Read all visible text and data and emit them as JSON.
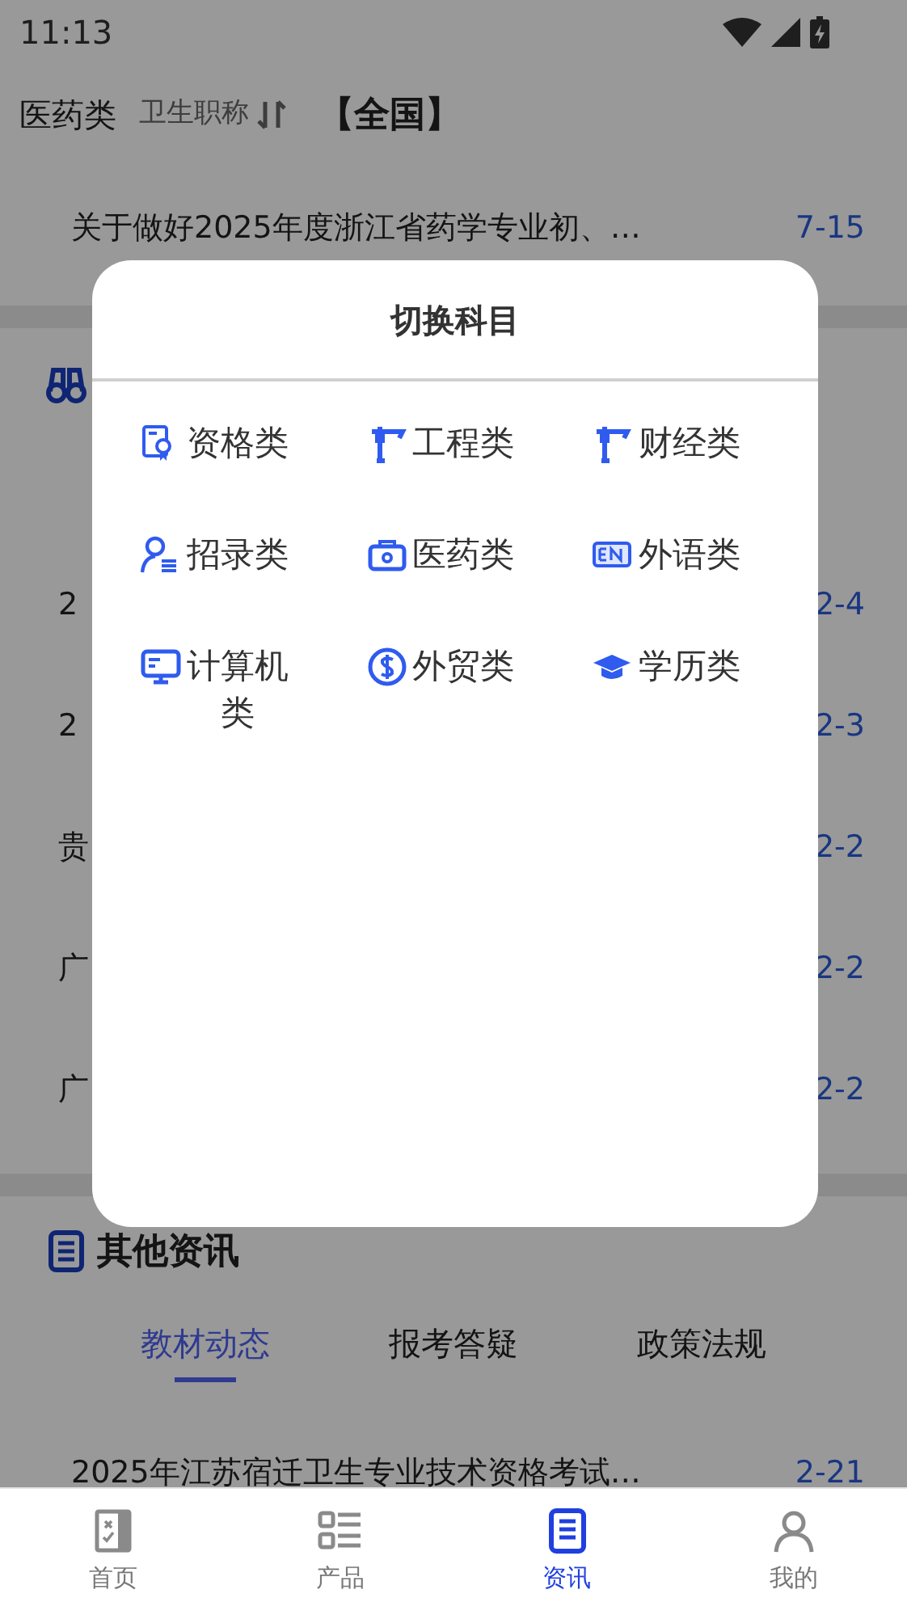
{
  "status_bar": {
    "time": "11:13"
  },
  "header": {
    "category": "医药类",
    "subcategory": "卫生职称",
    "region": "【全国】"
  },
  "top_news": [
    {
      "title": "关于做好2025年度浙江省药学专业初、…",
      "date": "7-15"
    }
  ],
  "section_rows": [
    {
      "title": "2",
      "date": "2-4"
    },
    {
      "title": "2",
      "date": "2-3"
    },
    {
      "title": "贵",
      "date": "2-2"
    },
    {
      "title": "广",
      "date": "2-2"
    },
    {
      "title": "广",
      "date": "2-2"
    }
  ],
  "modal": {
    "title": "切换科目",
    "subjects": [
      {
        "label": "资格类"
      },
      {
        "label": "工程类"
      },
      {
        "label": "财经类"
      },
      {
        "label": "招录类"
      },
      {
        "label": "医药类"
      },
      {
        "label": "外语类"
      },
      {
        "label": "计算机类"
      },
      {
        "label": "外贸类"
      },
      {
        "label": "学历类"
      }
    ]
  },
  "other_news": {
    "title": "其他资讯",
    "tabs": [
      {
        "label": "教材动态",
        "selected": true
      },
      {
        "label": "报考答疑",
        "selected": false
      },
      {
        "label": "政策法规",
        "selected": false
      }
    ],
    "items": [
      {
        "title": "2025年江苏宿迁卫生专业技术资格考试…",
        "date": "2-21"
      }
    ]
  },
  "bottom_nav": [
    {
      "label": "首页",
      "selected": false
    },
    {
      "label": "产品",
      "selected": false
    },
    {
      "label": "资讯",
      "selected": true
    },
    {
      "label": "我的",
      "selected": false
    }
  ]
}
